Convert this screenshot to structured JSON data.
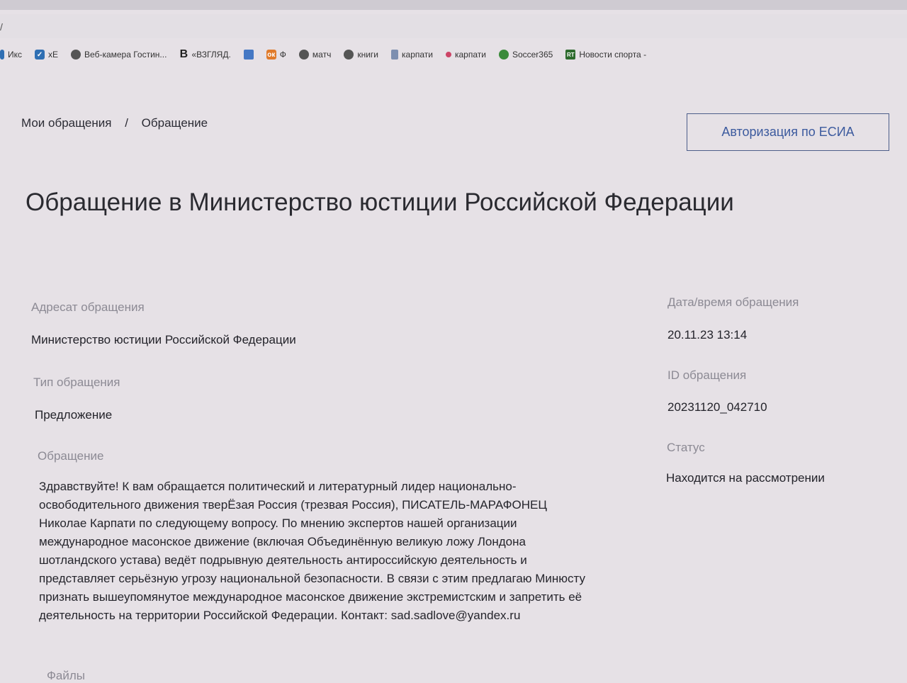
{
  "browser": {
    "url_fragment": "/",
    "bookmarks": [
      {
        "label": "Икс",
        "icon": "bookmark-icon"
      },
      {
        "label": "хЕ",
        "icon": "vk-icon"
      },
      {
        "label": "Веб-камера Гостин...",
        "icon": "globe-icon"
      },
      {
        "label": "«ВЗГЛЯД.",
        "icon": "vzglyad-icon"
      },
      {
        "label": "",
        "icon": "monitor-icon"
      },
      {
        "label": "Ф",
        "icon": "odnoklassniki-icon"
      },
      {
        "label": "матч",
        "icon": "globe-icon"
      },
      {
        "label": "книги",
        "icon": "globe-icon"
      },
      {
        "label": "карпати",
        "icon": "document-icon"
      },
      {
        "label": "карпати",
        "icon": "dot-icon"
      },
      {
        "label": "Soccer365",
        "icon": "soccer-ball-icon"
      },
      {
        "label": "Новости спорта -",
        "icon": "rt-icon"
      }
    ]
  },
  "breadcrumb": {
    "root": "Мои обращения",
    "separator": "/",
    "current": "Обращение"
  },
  "auth_button": "Авторизация по ЕСИА",
  "page_title": "Обращение в Министерство юстиции Российской Федерации",
  "fields": {
    "addressee_label": "Адресат обращения",
    "addressee_value": "Министерство юстиции Российской Федерации",
    "type_label": "Тип обращения",
    "type_value": "Предложение",
    "message_label": "Обращение",
    "message_text": "Здравствуйте! К вам обращается политический и литературный лидер национально-освободительного движения тверЁзая Россия (трезвая Россия), ПИСАТЕЛЬ-МАРАФОНЕЦ Николае Карпати по следующему вопросу. По мнению экспертов нашей организации международное масонское движение (включая Объединённую великую ложу Лондона шотландского устава) ведёт подрывную деятельность антироссийскую деятельность и представляет серьёзную угрозу национальной безопасности. В связи с этим предлагаю Минюсту признать вышеупомянутое международное масонское движение экстремистским и запретить её деятельность на территории Российской Федерации. Контакт: sad.sadlove@yandex.ru",
    "files_label": "Файлы",
    "datetime_label": "Дата/время обращения",
    "datetime_value": "20.11.23 13:14",
    "id_label": "ID обращения",
    "id_value": "20231120_042710",
    "status_label": "Статус",
    "status_value": "Находится на рассмотрении"
  },
  "colors": {
    "page_bg": "#e6e1e6",
    "accent": "#3c5a9e",
    "label": "#8c8a94",
    "text": "#23232a"
  }
}
